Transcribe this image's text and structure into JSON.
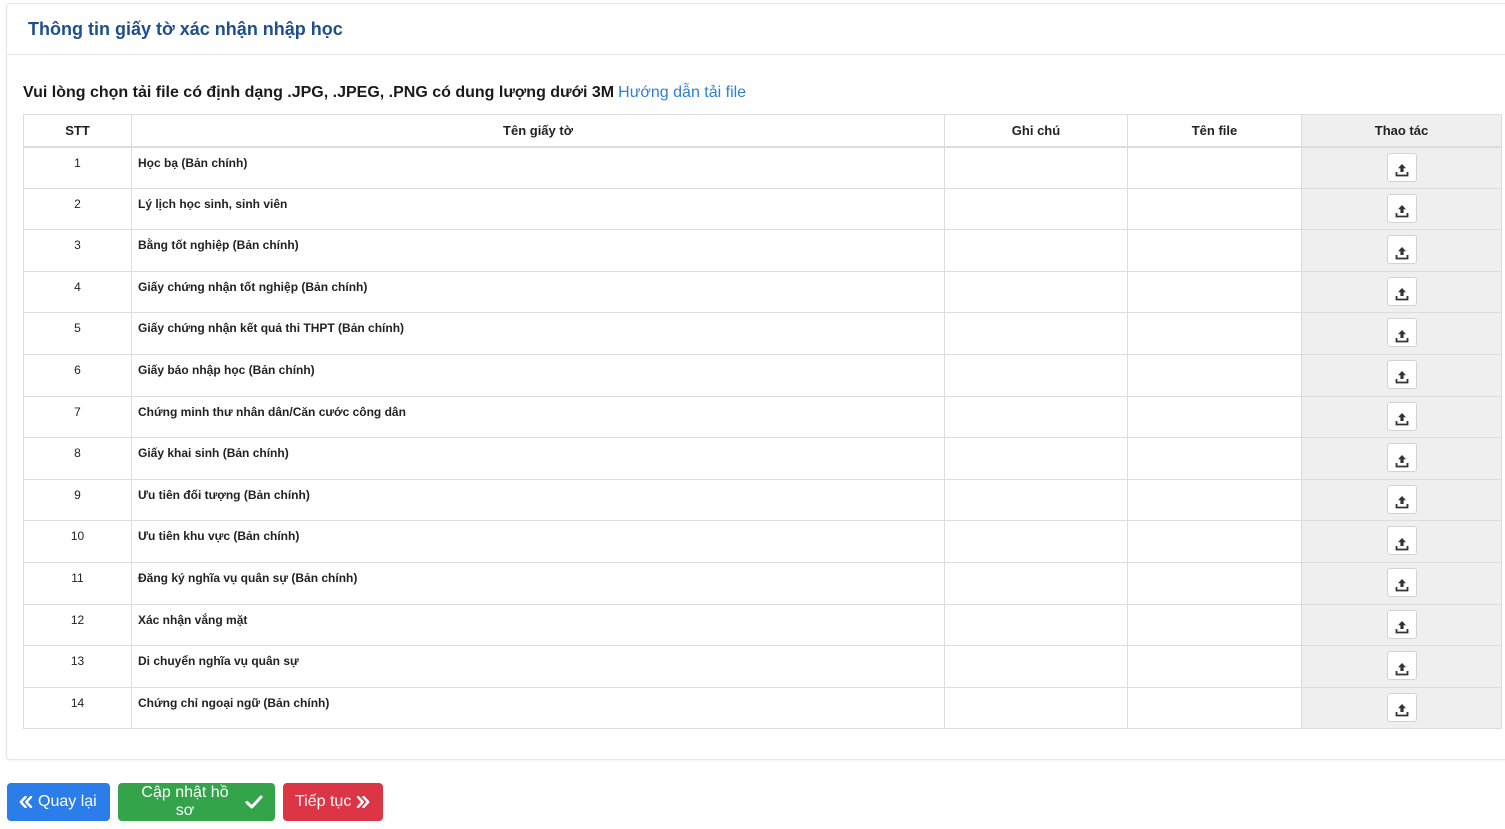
{
  "card": {
    "title": "Thông tin giấy tờ xác nhận nhập học"
  },
  "notice": {
    "text": "Vui lòng chọn tải file có định dạng .JPG, .JPEG, .PNG có dung lượng dưới 3M",
    "link_text": "Hướng dẫn tải file"
  },
  "table": {
    "headers": {
      "stt": "STT",
      "name": "Tên giấy tờ",
      "note": "Ghi chú",
      "file": "Tên file",
      "action": "Thao tác"
    },
    "rows": [
      {
        "stt": "1",
        "name": "Học bạ (Bản chính)",
        "note": "",
        "file": ""
      },
      {
        "stt": "2",
        "name": "Lý lịch học sinh, sinh viên",
        "note": "",
        "file": ""
      },
      {
        "stt": "3",
        "name": "Bằng tốt nghiệp (Bản chính)",
        "note": "",
        "file": ""
      },
      {
        "stt": "4",
        "name": "Giấy chứng nhận tốt nghiệp (Bản chính)",
        "note": "",
        "file": ""
      },
      {
        "stt": "5",
        "name": "Giấy chứng nhận kết quả thi THPT (Bản chính)",
        "note": "",
        "file": ""
      },
      {
        "stt": "6",
        "name": "Giấy báo nhập học (Bản chính)",
        "note": "",
        "file": ""
      },
      {
        "stt": "7",
        "name": "Chứng minh thư nhân dân/Căn cước công dân",
        "note": "",
        "file": ""
      },
      {
        "stt": "8",
        "name": "Giấy khai sinh (Bản chính)",
        "note": "",
        "file": ""
      },
      {
        "stt": "9",
        "name": "Ưu tiên đối tượng (Bản chính)",
        "note": "",
        "file": ""
      },
      {
        "stt": "10",
        "name": "Ưu tiên khu vực (Bản chính)",
        "note": "",
        "file": ""
      },
      {
        "stt": "11",
        "name": "Đăng ký nghĩa vụ quân sự (Bản chính)",
        "note": "",
        "file": ""
      },
      {
        "stt": "12",
        "name": "Xác nhận vắng mặt",
        "note": "",
        "file": ""
      },
      {
        "stt": "13",
        "name": "Di chuyển nghĩa vụ quân sự",
        "note": "",
        "file": ""
      },
      {
        "stt": "14",
        "name": "Chứng chỉ ngoại ngữ (Bản chính)",
        "note": "",
        "file": ""
      }
    ],
    "upload_icon": "upload-icon"
  },
  "buttons": {
    "back": {
      "label": "Quay lại",
      "icon": "double-chevron-left-icon"
    },
    "update": {
      "label": "Cập nhật hồ sơ",
      "icon": "checkmark-icon"
    },
    "next": {
      "label": "Tiếp tục",
      "icon": "double-chevron-right-icon"
    }
  },
  "colors": {
    "title": "#1f4e8c",
    "link": "#2f80d1",
    "primary": "#2b7de9",
    "success": "#34a44a",
    "danger": "#dc3545",
    "action_column_bg": "#efefef"
  }
}
